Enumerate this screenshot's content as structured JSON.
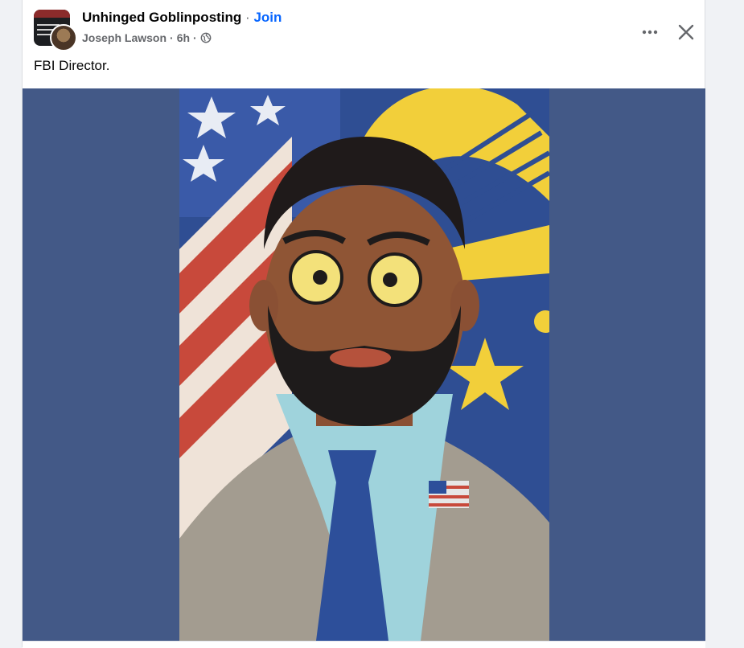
{
  "post": {
    "group_name": "Unhinged Goblinposting",
    "separator": "·",
    "join_label": "Join",
    "author": "Joseph Lawson",
    "time": "6h",
    "privacy_icon": "globe-icon",
    "text": "FBI Director."
  },
  "actions": {
    "more_icon": "more-horizontal-icon",
    "close_icon": "close-icon"
  },
  "colors": {
    "page_bg": "#f0f2f5",
    "card_bg": "#ffffff",
    "link_blue": "#0866ff",
    "meta_gray": "#65676b",
    "media_bg": "#435987"
  }
}
